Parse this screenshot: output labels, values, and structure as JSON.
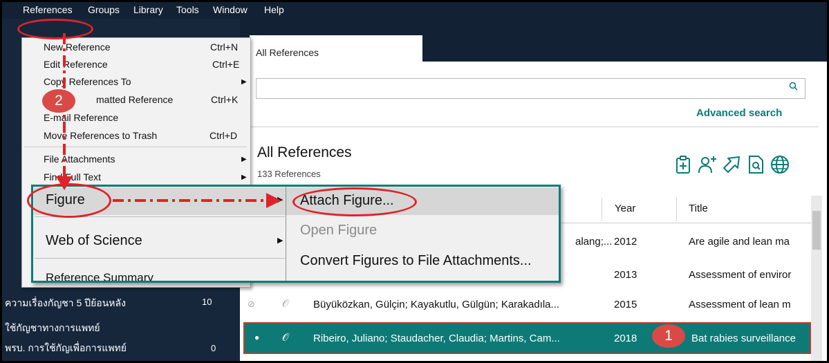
{
  "menubar": {
    "items": [
      "References",
      "Groups",
      "Library",
      "Tools",
      "Window",
      "Help"
    ]
  },
  "tab": {
    "label": "All References"
  },
  "search": {
    "placeholder": "",
    "advanced_label": "Advanced search"
  },
  "library": {
    "title": "All References",
    "count": "133 References"
  },
  "toolbar_icons": [
    "new-reference-icon",
    "add-user-icon",
    "share-icon",
    "find-pdf-icon",
    "web-icon"
  ],
  "table": {
    "headers": [
      "Year",
      "Title"
    ],
    "rows": [
      {
        "authors": "alang;...",
        "year": "2012",
        "title": "Are agile and lean ma",
        "selected": false
      },
      {
        "authors": "",
        "year": "2013",
        "title": "Assessment of enviror",
        "selected": false
      },
      {
        "authors": "Büyüközkan, Gülçin; Kayakutlu, Gülgün; Karakadıla...",
        "year": "2015",
        "title": "Assessment of lean m",
        "selected": false
      },
      {
        "authors": "Ribeiro, Juliano; Staudacher, Claudia; Martins, Cam...",
        "year": "2018",
        "title": "Bat rabies surveillance",
        "selected": true
      }
    ]
  },
  "sidebar": {
    "items": [
      {
        "label": "ความเรื่องกัญชา 5 ปีย้อนหลัง",
        "count": "10"
      },
      {
        "label": "ใช้กัญชาทางการแพทย์",
        "count": ""
      },
      {
        "label": "พรบ. การใช้กัญเพื่อการแพทย์",
        "count": "0"
      }
    ]
  },
  "references_menu": {
    "items": [
      {
        "label": "New Reference",
        "shortcut": "Ctrl+N",
        "submenu": false
      },
      {
        "label": "Edit Reference",
        "shortcut": "Ctrl+E",
        "submenu": false
      },
      {
        "label": "Copy References To",
        "shortcut": "",
        "submenu": true
      },
      {
        "label": "matted Reference",
        "shortcut": "Ctrl+K",
        "submenu": false
      },
      {
        "label": "E-mail Reference",
        "shortcut": "",
        "submenu": false
      },
      {
        "label": "Move References to Trash",
        "shortcut": "Ctrl+D",
        "submenu": false
      },
      {
        "label": "File Attachments",
        "shortcut": "",
        "submenu": true
      },
      {
        "label": "Find Full Text",
        "shortcut": "",
        "submenu": true
      },
      {
        "label": "Reference Summary",
        "shortcut": "",
        "submenu": false
      }
    ]
  },
  "zoom_menu": {
    "left": [
      "Figure",
      "Web of Science",
      "Reference Summary"
    ],
    "right": [
      {
        "label": "Attach Figure...",
        "disabled": false
      },
      {
        "label": "Open Figure",
        "disabled": true
      },
      {
        "label": "Convert Figures to File Attachments...",
        "disabled": false
      }
    ]
  },
  "annotations": {
    "step1": "1",
    "step2": "2"
  },
  "colors": {
    "accent": "#0b7a78",
    "callout": "#e0222a",
    "badge": "#d94a46",
    "nav_bg": "#122134"
  }
}
